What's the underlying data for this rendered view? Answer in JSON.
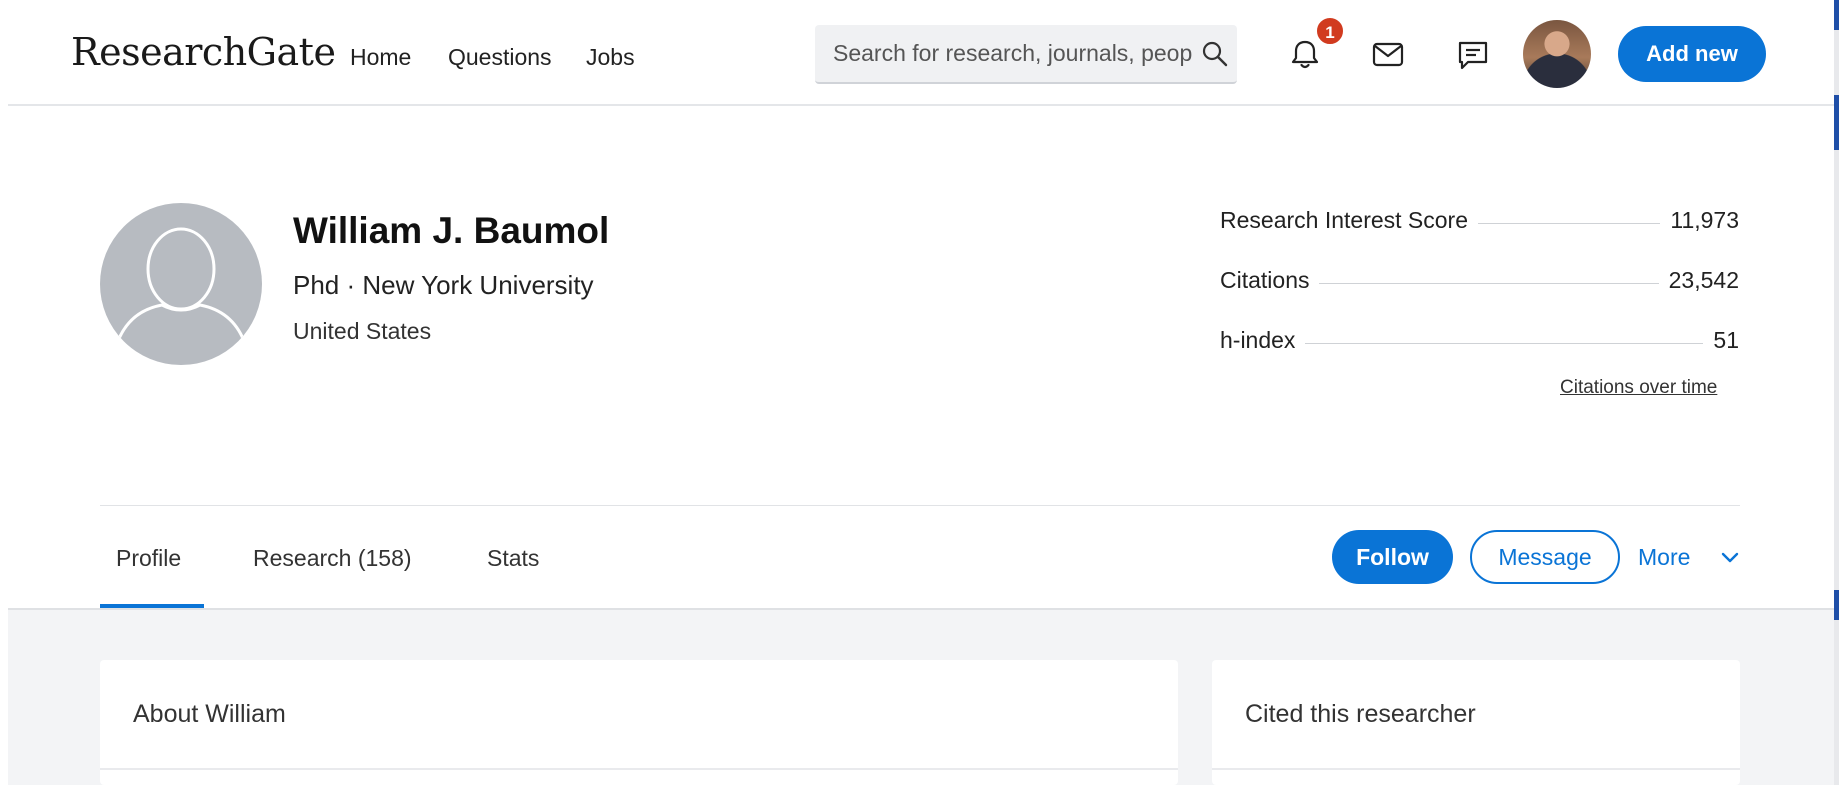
{
  "header": {
    "logo": "ResearchGate",
    "nav": [
      "Home",
      "Questions",
      "Jobs"
    ],
    "search_placeholder": "Search for research, journals, people",
    "notification_count": "1",
    "add_new_label": "Add new",
    "icons": [
      "bell-icon",
      "mail-icon",
      "chat-icon",
      "search-icon"
    ]
  },
  "profile": {
    "name": "William J. Baumol",
    "subtitle": "Phd · New York University",
    "location": "United States"
  },
  "stats": [
    {
      "label": "Research Interest Score",
      "value": "11,973"
    },
    {
      "label": "Citations",
      "value": "23,542"
    },
    {
      "label": "h-index",
      "value": "51"
    }
  ],
  "citations_link": "Citations over time",
  "tabs": [
    {
      "label": "Profile",
      "active": true
    },
    {
      "label": "Research (158)",
      "active": false
    },
    {
      "label": "Stats",
      "active": false
    }
  ],
  "actions": {
    "follow": "Follow",
    "message": "Message",
    "more": "More"
  },
  "cards": {
    "about_title": "About William",
    "cited_title": "Cited this researcher"
  },
  "colors": {
    "accent": "#0a74d6",
    "badge": "#d13b1f",
    "avatar_placeholder": "#b7bbc1"
  }
}
